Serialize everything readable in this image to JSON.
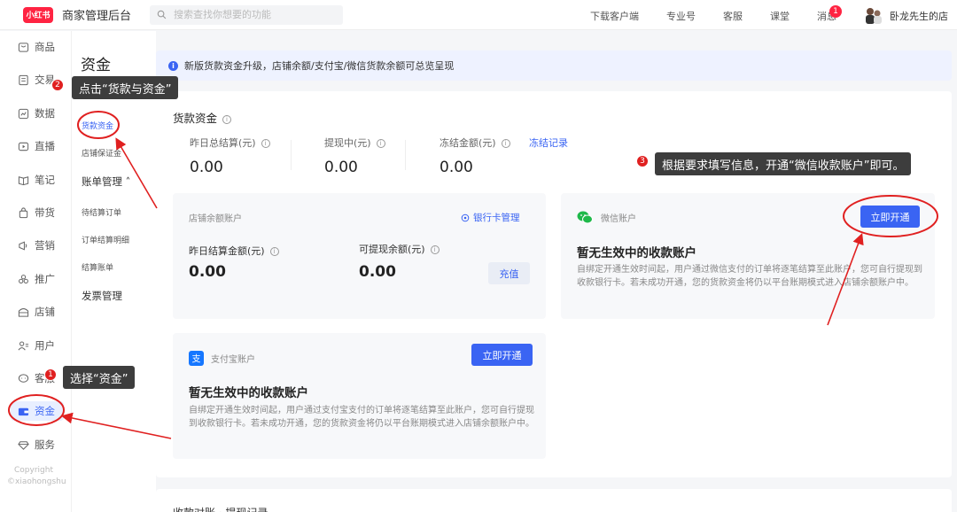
{
  "topbar": {
    "logo": "小红书",
    "app_title": "商家管理后台",
    "search_placeholder": "搜索查找你想要的功能",
    "links": [
      "下载客户端",
      "专业号",
      "客服",
      "课堂",
      "消息"
    ],
    "message_badge": "1",
    "shop_name": "卧龙先生的店"
  },
  "leftnav": {
    "items": [
      {
        "label": "商品",
        "icon": "box-icon"
      },
      {
        "label": "交易",
        "icon": "receipt-icon"
      },
      {
        "label": "数据",
        "icon": "chart-icon"
      },
      {
        "label": "直播",
        "icon": "live-icon"
      },
      {
        "label": "笔记",
        "icon": "book-icon"
      },
      {
        "label": "带货",
        "icon": "bag-icon"
      },
      {
        "label": "营销",
        "icon": "megaphone-icon"
      },
      {
        "label": "推广",
        "icon": "share-icon"
      },
      {
        "label": "店铺",
        "icon": "store-icon"
      },
      {
        "label": "用户",
        "icon": "users-icon"
      },
      {
        "label": "客服",
        "icon": "chat-icon"
      },
      {
        "label": "资金",
        "icon": "wallet-icon"
      },
      {
        "label": "服务",
        "icon": "diamond-icon"
      }
    ],
    "copyright_line1": "Copyright",
    "copyright_line2": "©xiaohongshu"
  },
  "subnav": {
    "title": "资金",
    "items": [
      {
        "label": "货款资金",
        "active": true
      },
      {
        "label": "店铺保证金",
        "active": false
      }
    ],
    "group_billing": "账单管理 ˄",
    "billing_items": [
      "待结算订单",
      "订单结算明细",
      "结算账单"
    ],
    "group_invoice": "发票管理"
  },
  "notice": {
    "text": "新版货款资金升级，店铺余额/支付宝/微信货款余额可总览呈现"
  },
  "funds": {
    "title": "货款资金",
    "stats": [
      {
        "label": "昨日总结算(元)",
        "value": "0.00"
      },
      {
        "label": "提现中(元)",
        "value": "0.00"
      },
      {
        "label": "冻结金额(元)",
        "value": "0.00"
      }
    ],
    "freeze_link": "冻结记录"
  },
  "store_account": {
    "title": "店铺余额账户",
    "bank_link": "银行卡管理",
    "yesterday_label": "昨日结算金额(元)",
    "yesterday_value": "0.00",
    "withdrawable_label": "可提现余额(元)",
    "withdrawable_value": "0.00",
    "recharge_button": "充值"
  },
  "wechat_account": {
    "title": "微信账户",
    "open_button": "立即开通",
    "heading": "暂无生效中的收款账户",
    "desc": "自绑定开通生效时间起，用户通过微信支付的订单将逐笔结算至此账户，您可自行提现到收款银行卡。若未成功开通，您的货款资金将仍以平台账期模式进入店铺余额账户中。"
  },
  "alipay_account": {
    "title": "支付宝账户",
    "open_button": "立即开通",
    "heading": "暂无生效中的收款账户",
    "desc": "自绑定开通生效时间起，用户通过支付宝支付的订单将逐笔结算至此账户，您可自行提现到收款银行卡。若未成功开通，您的货款资金将仍以平台账期模式进入店铺余额账户中。"
  },
  "panel2_title": "收款对账 · 提现记录",
  "annotations": [
    {
      "num": "1",
      "text": "选择“资金”"
    },
    {
      "num": "2",
      "text": "点击“货款与资金”"
    },
    {
      "num": "3",
      "text": "根据要求填写信息，开通“微信收款账户”即可。"
    }
  ],
  "colors": {
    "brand": "#ff2442",
    "accent": "#3a64f3",
    "annotation": "#e02020"
  }
}
